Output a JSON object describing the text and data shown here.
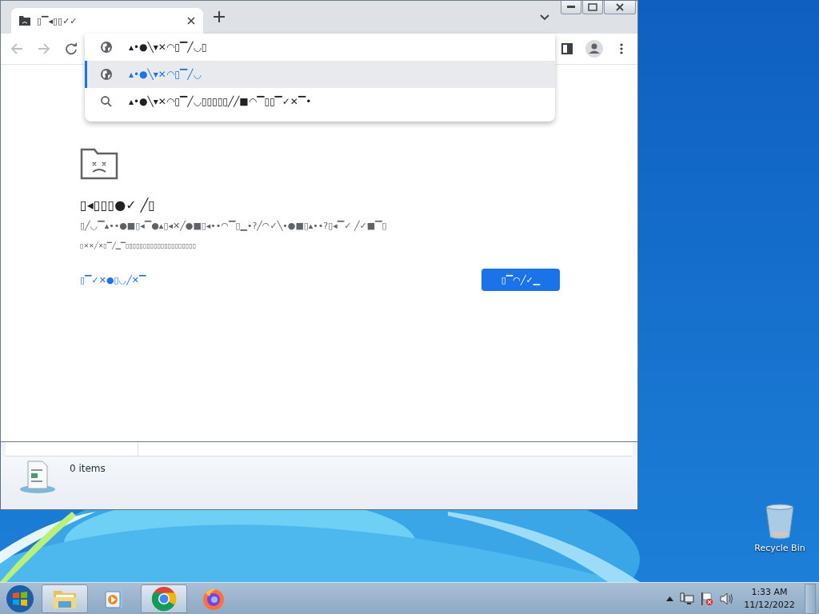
{
  "browser": {
    "tab": {
      "title": "▯▔◂▯▯✓✓"
    },
    "suggestions": [
      {
        "kind": "globe",
        "text": "▴•●╲▾✕◠▯▔╱◡▯",
        "selected": false
      },
      {
        "kind": "globe",
        "text": "▴•●╲▾✕◠▯▔╱◡",
        "selected": true
      },
      {
        "kind": "search",
        "text": "▴•●╲▾✕◠▯▔╱◡▯▯▯▯▯╱╱■◠▔▯▯▔✓✕▔•",
        "selected": false
      }
    ],
    "page": {
      "heading": "▯◂▯▯▯●✓ ╱▯",
      "paragraphs": [
        "▯╱◡▔▴••●■▯◂▔●▴▯◂✕╱●■▯◂••◠▔▯▁•?╱◠✓╲•●■▯▴••?▯◂▔✓ ╱✓■▔▯",
        "▯✕✕╱✕▯▔╱▁▔▯▯▯▯▯▯▯▯▯▯▯▯▯▯▯▯▯▯▯▯"
      ],
      "link": "▯▔✓✕●▯◡╱✕▔",
      "button": "▯▔◠╱✓▁"
    }
  },
  "explorer": {
    "status": "0 items"
  },
  "desktop": {
    "icons": [
      {
        "label": "Recycle Bin"
      }
    ]
  },
  "taskbar": {
    "apps": [
      {
        "kind": "explorer",
        "running": true
      },
      {
        "kind": "media",
        "running": false
      },
      {
        "kind": "chrome",
        "running": true
      },
      {
        "kind": "firefox",
        "running": false
      }
    ],
    "clock": {
      "time": "1:33 AM",
      "date": "11/12/2022"
    }
  }
}
